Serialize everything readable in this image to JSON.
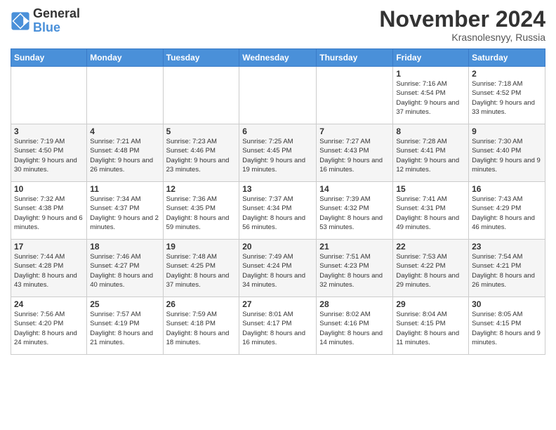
{
  "logo": {
    "text_general": "General",
    "text_blue": "Blue"
  },
  "header": {
    "month_year": "November 2024",
    "location": "Krasnolesnyy, Russia"
  },
  "days_of_week": [
    "Sunday",
    "Monday",
    "Tuesday",
    "Wednesday",
    "Thursday",
    "Friday",
    "Saturday"
  ],
  "weeks": [
    [
      {
        "day": "",
        "info": ""
      },
      {
        "day": "",
        "info": ""
      },
      {
        "day": "",
        "info": ""
      },
      {
        "day": "",
        "info": ""
      },
      {
        "day": "",
        "info": ""
      },
      {
        "day": "1",
        "info": "Sunrise: 7:16 AM\nSunset: 4:54 PM\nDaylight: 9 hours and 37 minutes."
      },
      {
        "day": "2",
        "info": "Sunrise: 7:18 AM\nSunset: 4:52 PM\nDaylight: 9 hours and 33 minutes."
      }
    ],
    [
      {
        "day": "3",
        "info": "Sunrise: 7:19 AM\nSunset: 4:50 PM\nDaylight: 9 hours and 30 minutes."
      },
      {
        "day": "4",
        "info": "Sunrise: 7:21 AM\nSunset: 4:48 PM\nDaylight: 9 hours and 26 minutes."
      },
      {
        "day": "5",
        "info": "Sunrise: 7:23 AM\nSunset: 4:46 PM\nDaylight: 9 hours and 23 minutes."
      },
      {
        "day": "6",
        "info": "Sunrise: 7:25 AM\nSunset: 4:45 PM\nDaylight: 9 hours and 19 minutes."
      },
      {
        "day": "7",
        "info": "Sunrise: 7:27 AM\nSunset: 4:43 PM\nDaylight: 9 hours and 16 minutes."
      },
      {
        "day": "8",
        "info": "Sunrise: 7:28 AM\nSunset: 4:41 PM\nDaylight: 9 hours and 12 minutes."
      },
      {
        "day": "9",
        "info": "Sunrise: 7:30 AM\nSunset: 4:40 PM\nDaylight: 9 hours and 9 minutes."
      }
    ],
    [
      {
        "day": "10",
        "info": "Sunrise: 7:32 AM\nSunset: 4:38 PM\nDaylight: 9 hours and 6 minutes."
      },
      {
        "day": "11",
        "info": "Sunrise: 7:34 AM\nSunset: 4:37 PM\nDaylight: 9 hours and 2 minutes."
      },
      {
        "day": "12",
        "info": "Sunrise: 7:36 AM\nSunset: 4:35 PM\nDaylight: 8 hours and 59 minutes."
      },
      {
        "day": "13",
        "info": "Sunrise: 7:37 AM\nSunset: 4:34 PM\nDaylight: 8 hours and 56 minutes."
      },
      {
        "day": "14",
        "info": "Sunrise: 7:39 AM\nSunset: 4:32 PM\nDaylight: 8 hours and 53 minutes."
      },
      {
        "day": "15",
        "info": "Sunrise: 7:41 AM\nSunset: 4:31 PM\nDaylight: 8 hours and 49 minutes."
      },
      {
        "day": "16",
        "info": "Sunrise: 7:43 AM\nSunset: 4:29 PM\nDaylight: 8 hours and 46 minutes."
      }
    ],
    [
      {
        "day": "17",
        "info": "Sunrise: 7:44 AM\nSunset: 4:28 PM\nDaylight: 8 hours and 43 minutes."
      },
      {
        "day": "18",
        "info": "Sunrise: 7:46 AM\nSunset: 4:27 PM\nDaylight: 8 hours and 40 minutes."
      },
      {
        "day": "19",
        "info": "Sunrise: 7:48 AM\nSunset: 4:25 PM\nDaylight: 8 hours and 37 minutes."
      },
      {
        "day": "20",
        "info": "Sunrise: 7:49 AM\nSunset: 4:24 PM\nDaylight: 8 hours and 34 minutes."
      },
      {
        "day": "21",
        "info": "Sunrise: 7:51 AM\nSunset: 4:23 PM\nDaylight: 8 hours and 32 minutes."
      },
      {
        "day": "22",
        "info": "Sunrise: 7:53 AM\nSunset: 4:22 PM\nDaylight: 8 hours and 29 minutes."
      },
      {
        "day": "23",
        "info": "Sunrise: 7:54 AM\nSunset: 4:21 PM\nDaylight: 8 hours and 26 minutes."
      }
    ],
    [
      {
        "day": "24",
        "info": "Sunrise: 7:56 AM\nSunset: 4:20 PM\nDaylight: 8 hours and 24 minutes."
      },
      {
        "day": "25",
        "info": "Sunrise: 7:57 AM\nSunset: 4:19 PM\nDaylight: 8 hours and 21 minutes."
      },
      {
        "day": "26",
        "info": "Sunrise: 7:59 AM\nSunset: 4:18 PM\nDaylight: 8 hours and 18 minutes."
      },
      {
        "day": "27",
        "info": "Sunrise: 8:01 AM\nSunset: 4:17 PM\nDaylight: 8 hours and 16 minutes."
      },
      {
        "day": "28",
        "info": "Sunrise: 8:02 AM\nSunset: 4:16 PM\nDaylight: 8 hours and 14 minutes."
      },
      {
        "day": "29",
        "info": "Sunrise: 8:04 AM\nSunset: 4:15 PM\nDaylight: 8 hours and 11 minutes."
      },
      {
        "day": "30",
        "info": "Sunrise: 8:05 AM\nSunset: 4:15 PM\nDaylight: 8 hours and 9 minutes."
      }
    ]
  ]
}
